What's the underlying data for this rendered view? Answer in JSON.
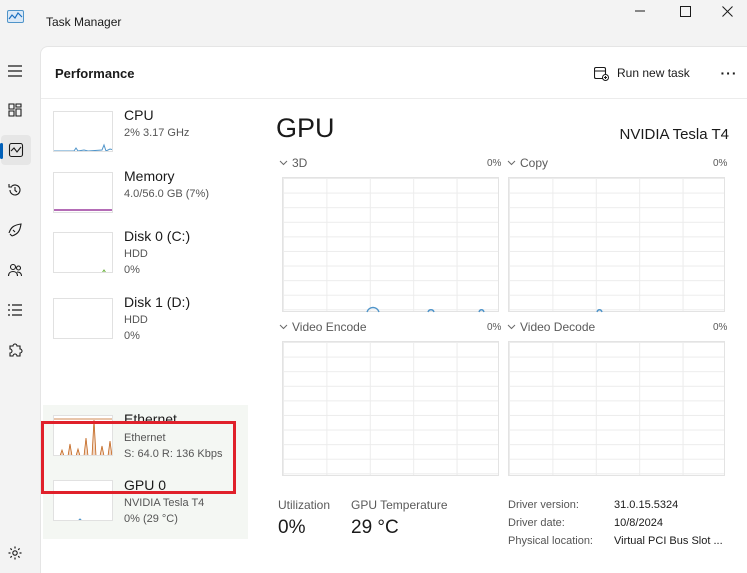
{
  "app": {
    "title": "Task Manager"
  },
  "header": {
    "title": "Performance",
    "run_task_label": "Run new task",
    "more_label": "···"
  },
  "devices": [
    {
      "name": "CPU",
      "line1": "2% 3.17 GHz",
      "line2": ""
    },
    {
      "name": "Memory",
      "line1": "4.0/56.0 GB (7%)",
      "line2": ""
    },
    {
      "name": "Disk 0 (C:)",
      "line1": "HDD",
      "line2": "0%"
    },
    {
      "name": "Disk 1 (D:)",
      "line1": "HDD",
      "line2": "0%"
    },
    {
      "name": "Ethernet",
      "line1": "Ethernet",
      "line2": "S: 64.0  R: 136 Kbps"
    },
    {
      "name": "GPU 0",
      "line1": "NVIDIA Tesla T4",
      "line2": "0%  (29 °C)"
    }
  ],
  "detail": {
    "title": "GPU",
    "model": "NVIDIA Tesla T4",
    "graphs": [
      {
        "label": "3D",
        "percent": "0%"
      },
      {
        "label": "Copy",
        "percent": "0%"
      },
      {
        "label": "Video Encode",
        "percent": "0%"
      },
      {
        "label": "Video Decode",
        "percent": "0%"
      }
    ],
    "stats": {
      "utilization_label": "Utilization",
      "utilization_value": "0%",
      "temp_label": "GPU Temperature",
      "temp_value": "29 °C"
    },
    "properties": [
      {
        "key": "Driver version:",
        "value": "31.0.15.5324"
      },
      {
        "key": "Driver date:",
        "value": "10/8/2024"
      },
      {
        "key": "Physical location:",
        "value": "Virtual PCI Bus Slot ..."
      }
    ]
  },
  "colors": {
    "cpu": "#4f94c9",
    "memory": "#9b3b9e",
    "disk": "#6cb33f",
    "ethernet": "#c2651d",
    "gpu": "#4f94c9",
    "accent": "#005fb8",
    "highlight": "#e0202a"
  }
}
